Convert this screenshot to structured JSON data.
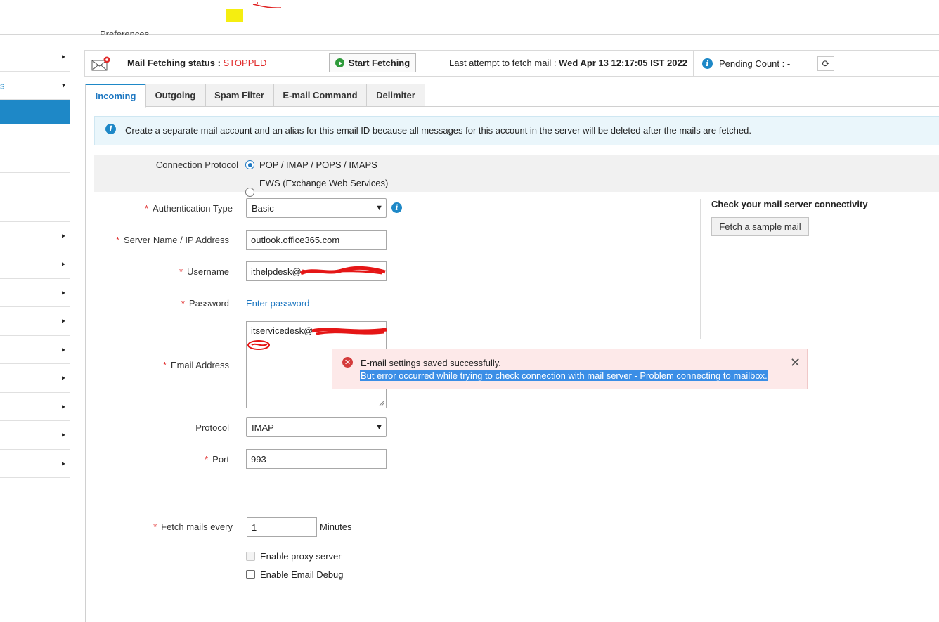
{
  "header": {
    "cut_title": "Preferences"
  },
  "status_bar": {
    "status_label": "Mail Fetching status :",
    "status_value": "STOPPED",
    "start_button": "Start Fetching",
    "last_attempt_label": "Last attempt to fetch mail :",
    "last_attempt_value": "Wed Apr 13 12:17:05 IST 2022",
    "pending_label": "Pending Count : -"
  },
  "tabs": [
    {
      "label": "Incoming",
      "active": true
    },
    {
      "label": "Outgoing"
    },
    {
      "label": "Spam Filter"
    },
    {
      "label": "E-mail Command"
    },
    {
      "label": "Delimiter"
    }
  ],
  "info_banner": "Create a separate mail account and an alias for this email ID because all messages for this account in the server will be deleted after the mails are fetched.",
  "form": {
    "connection_protocol_label": "Connection Protocol",
    "protocol_options": [
      "POP / IMAP / POPS / IMAPS",
      "EWS (Exchange Web Services)"
    ],
    "auth_type_label": "Authentication Type",
    "auth_type_value": "Basic",
    "server_label": "Server Name / IP Address",
    "server_value": "outlook.office365.com",
    "username_label": "Username",
    "username_value": "ithelpdesk@",
    "password_label": "Password",
    "password_link": "Enter password",
    "email_label": "Email Address",
    "email_value": "itservicedesk@",
    "protocol_label": "Protocol",
    "protocol_value": "IMAP",
    "port_label": "Port",
    "port_value": "993",
    "fetch_every_label": "Fetch mails every",
    "fetch_every_value": "1",
    "fetch_every_unit": "Minutes",
    "proxy_label": "Enable proxy server",
    "debug_label": "Enable Email Debug"
  },
  "connectivity": {
    "title": "Check your mail server connectivity",
    "button": "Fetch a sample mail"
  },
  "toast": {
    "line1": "E-mail settings saved successfully.",
    "line2": "But error occurred while trying to check connection with mail server - Problem connecting to mailbox."
  },
  "colors": {
    "accent": "#1e88c7",
    "error_red": "#e02a2a",
    "toast_bg": "#fde9e9",
    "selection_blue": "#3b8ee6"
  }
}
